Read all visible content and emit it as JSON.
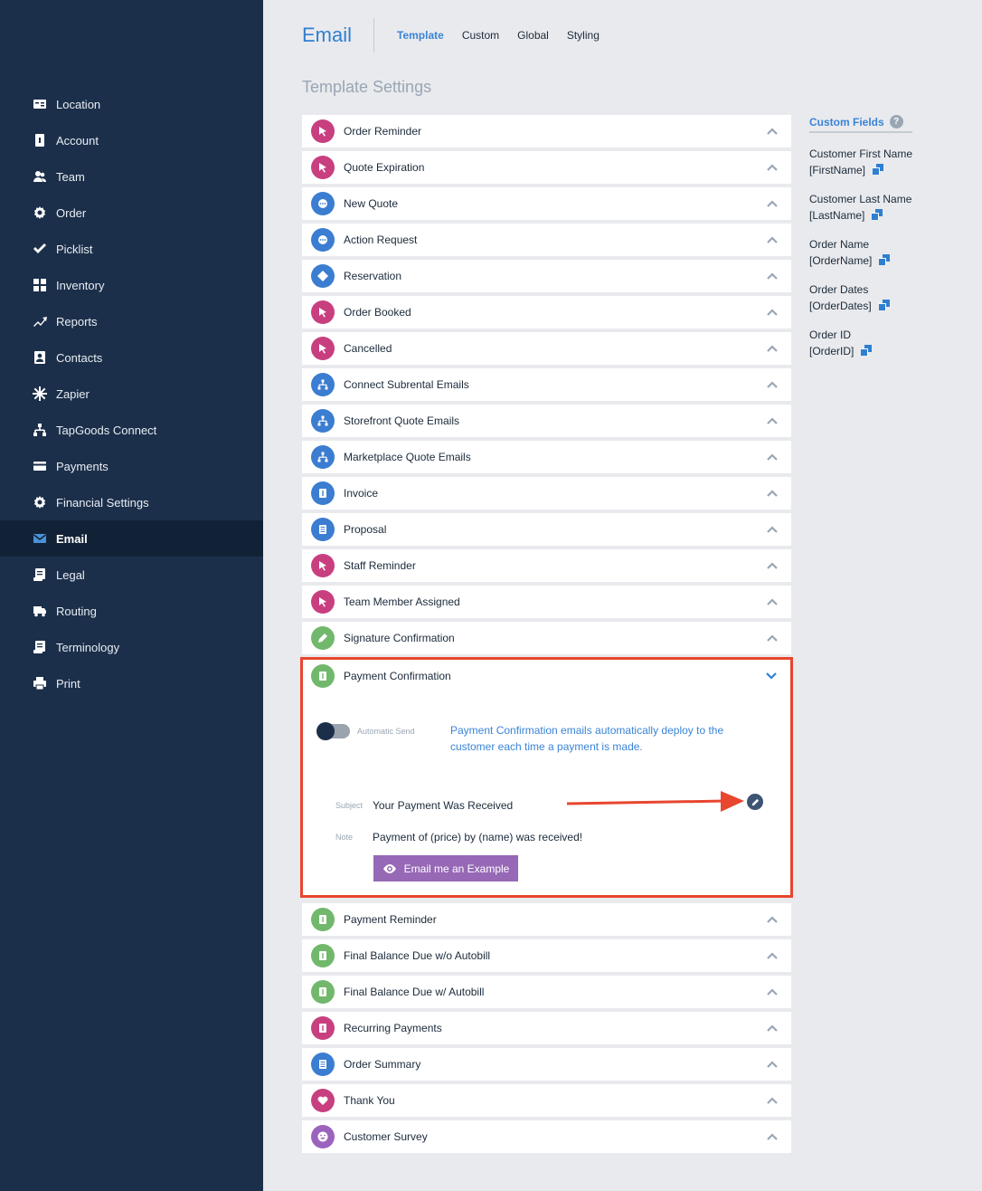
{
  "sidebar": {
    "items": [
      {
        "label": "Location",
        "icon": "id-card-icon"
      },
      {
        "label": "Account",
        "icon": "account-icon"
      },
      {
        "label": "Team",
        "icon": "team-icon"
      },
      {
        "label": "Order",
        "icon": "gear-icon"
      },
      {
        "label": "Picklist",
        "icon": "check-icon"
      },
      {
        "label": "Inventory",
        "icon": "grid-icon"
      },
      {
        "label": "Reports",
        "icon": "trend-icon"
      },
      {
        "label": "Contacts",
        "icon": "contact-icon"
      },
      {
        "label": "Zapier",
        "icon": "asterisk-icon"
      },
      {
        "label": "TapGoods Connect",
        "icon": "network-icon"
      },
      {
        "label": "Payments",
        "icon": "card-icon"
      },
      {
        "label": "Financial Settings",
        "icon": "gear-icon"
      },
      {
        "label": "Email",
        "icon": "envelope-icon",
        "active": true
      },
      {
        "label": "Legal",
        "icon": "scroll-icon"
      },
      {
        "label": "Routing",
        "icon": "truck-icon"
      },
      {
        "label": "Terminology",
        "icon": "scroll-icon"
      },
      {
        "label": "Print",
        "icon": "printer-icon"
      }
    ]
  },
  "header": {
    "title": "Email",
    "tabs": [
      {
        "label": "Template",
        "active": true
      },
      {
        "label": "Custom"
      },
      {
        "label": "Global"
      },
      {
        "label": "Styling"
      }
    ]
  },
  "section_title": "Template Settings",
  "templates_before": [
    {
      "label": "Order Reminder",
      "color": "#c83f7f",
      "icon": "pointer-icon"
    },
    {
      "label": "Quote Expiration",
      "color": "#c83f7f",
      "icon": "pointer-icon"
    },
    {
      "label": "New Quote",
      "color": "#3b7dd0",
      "icon": "chat-icon"
    },
    {
      "label": "Action Request",
      "color": "#3b7dd0",
      "icon": "chat-icon"
    },
    {
      "label": "Reservation",
      "color": "#3b7dd0",
      "icon": "ticket-icon"
    },
    {
      "label": "Order Booked",
      "color": "#c83f7f",
      "icon": "pointer-icon"
    },
    {
      "label": "Cancelled",
      "color": "#c83f7f",
      "icon": "pointer-icon"
    },
    {
      "label": "Connect Subrental Emails",
      "color": "#3b7dd0",
      "icon": "network-icon"
    },
    {
      "label": "Storefront Quote Emails",
      "color": "#3b7dd0",
      "icon": "network-icon"
    },
    {
      "label": "Marketplace Quote Emails",
      "color": "#3b7dd0",
      "icon": "network-icon"
    },
    {
      "label": "Invoice",
      "color": "#3b7dd0",
      "icon": "dollar-doc-icon"
    },
    {
      "label": "Proposal",
      "color": "#3b7dd0",
      "icon": "document-icon"
    },
    {
      "label": "Staff Reminder",
      "color": "#c83f7f",
      "icon": "pointer-icon"
    },
    {
      "label": "Team Member Assigned",
      "color": "#c83f7f",
      "icon": "pointer-icon"
    },
    {
      "label": "Signature Confirmation",
      "color": "#72b86c",
      "icon": "pen-icon"
    }
  ],
  "expanded": {
    "label": "Payment Confirmation",
    "color": "#72b86c",
    "icon": "dollar-doc-icon",
    "toggle_label": "Automatic Send",
    "description": "Payment Confirmation emails automatically deploy to the customer each time a payment is made.",
    "subject_label": "Subject",
    "subject_value": "Your Payment Was Received",
    "note_label": "Note",
    "note_value": "Payment of (price) by (name) was received!",
    "example_button": "Email me an Example"
  },
  "templates_after": [
    {
      "label": "Payment Reminder",
      "color": "#72b86c",
      "icon": "dollar-doc-icon"
    },
    {
      "label": "Final Balance Due w/o Autobill",
      "color": "#72b86c",
      "icon": "dollar-doc-icon"
    },
    {
      "label": "Final Balance Due w/ Autobill",
      "color": "#72b86c",
      "icon": "dollar-doc-icon"
    },
    {
      "label": "Recurring Payments",
      "color": "#c83f7f",
      "icon": "dollar-doc-icon"
    },
    {
      "label": "Order Summary",
      "color": "#3b7dd0",
      "icon": "document-icon"
    },
    {
      "label": "Thank You",
      "color": "#c83f7f",
      "icon": "heart-icon"
    },
    {
      "label": "Customer Survey",
      "color": "#9b63be",
      "icon": "smile-icon"
    }
  ],
  "custom_fields": {
    "title": "Custom Fields",
    "help": "?",
    "items": [
      {
        "name": "Customer First Name",
        "code": "[FirstName]"
      },
      {
        "name": "Customer Last Name",
        "code": "[LastName]"
      },
      {
        "name": "Order Name",
        "code": "[OrderName]"
      },
      {
        "name": "Order Dates",
        "code": "[OrderDates]"
      },
      {
        "name": "Order ID",
        "code": "[OrderID]"
      }
    ]
  },
  "colors": {
    "sidebar": "#1c2f4a",
    "accent": "#2f7fd1",
    "highlight": "#e8462f",
    "button": "#9668b6"
  }
}
